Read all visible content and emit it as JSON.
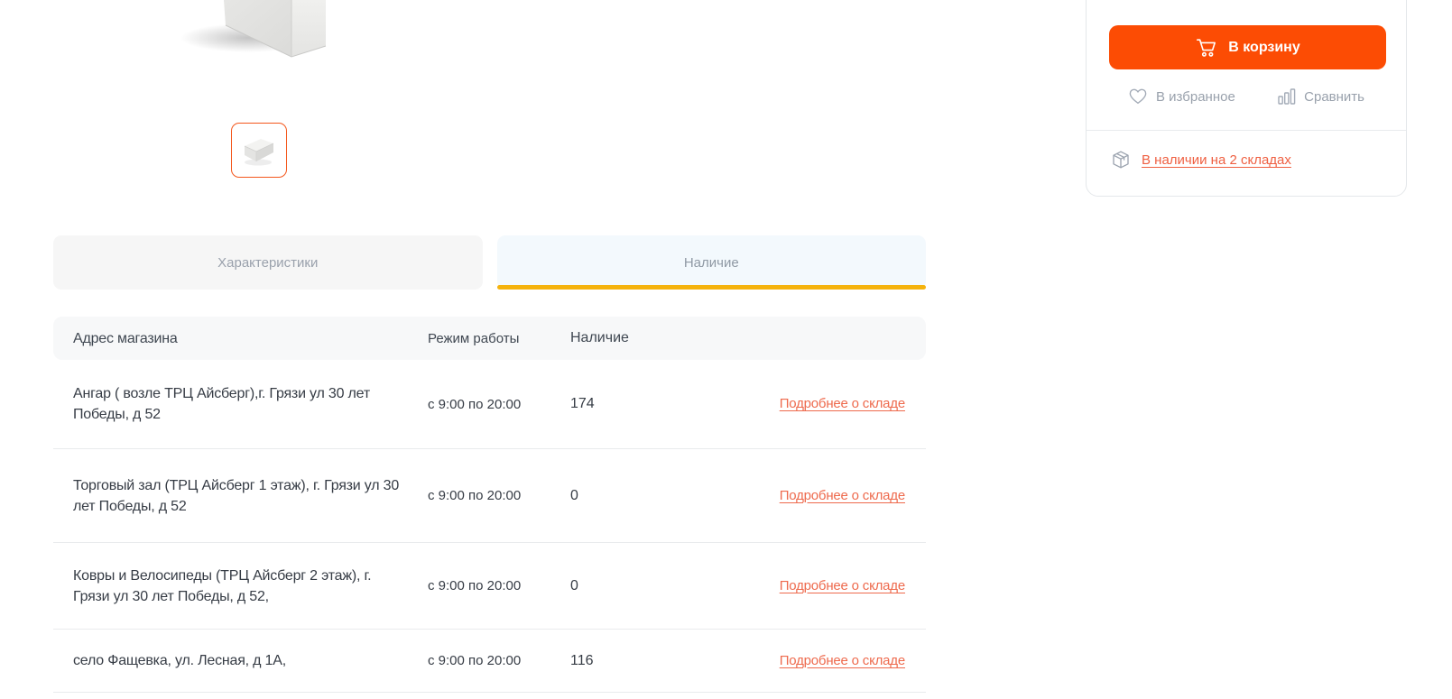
{
  "product": {
    "main_image": "white-aerated-concrete-block",
    "thumbnail_selected": true,
    "cart_button_label": "В корзину",
    "favorites_label": "В избранное",
    "compare_label": "Сравнить",
    "stock_link_label": "В наличии на 2 складах"
  },
  "tabs": [
    {
      "label": "Характеристики",
      "active": false
    },
    {
      "label": "Наличие",
      "active": true
    }
  ],
  "availability_table": {
    "headers": [
      "Адрес магазина",
      "Режим работы",
      "Наличие"
    ],
    "details_link_label": "Подробнее о складе",
    "rows": [
      {
        "address": "Ангар ( возле ТРЦ Айсберг),г. Грязи ул 30 лет Победы, д 52",
        "hours": "с 9:00 по 20:00",
        "qty": "174"
      },
      {
        "address": "Торговый зал (ТРЦ Айсберг 1 этаж), г. Грязи ул 30 лет Победы, д 52",
        "hours": "с 9:00 по 20:00",
        "qty": "0"
      },
      {
        "address": "Ковры и Велосипеды (ТРЦ Айсберг 2 этаж), г. Грязи ул 30 лет Победы, д 52,",
        "hours": "с 9:00 по 20:00",
        "qty": "0"
      },
      {
        "address": "село Фащевка, ул. Лесная, д 1А,",
        "hours": "с 9:00 по 20:00",
        "qty": "116"
      }
    ]
  },
  "colors": {
    "accent_orange": "#fc4c04",
    "link_orange": "#ee6a4d",
    "stock_link_orange": "#ef5f41",
    "thumbnail_border": "#f4571c",
    "tab_active_bg": "#f3f9fd",
    "tab_inactive_bg": "#f6f6f6",
    "tab_indicator_yellow": "#f5b30d",
    "table_header_bg": "#f7f8f9"
  }
}
